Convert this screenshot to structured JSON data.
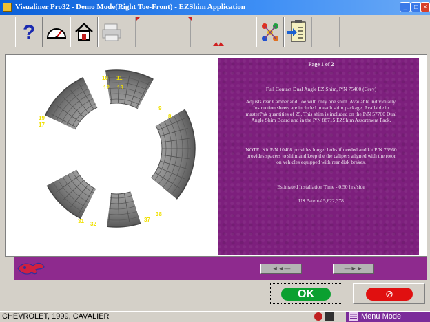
{
  "window": {
    "title": "Visualiner Pro32 - Demo Mode(Right Toe-Front) - EZShim Application"
  },
  "toolbar": {
    "items": [
      {
        "name": "help-icon"
      },
      {
        "name": "gauge-icon"
      },
      {
        "name": "home-icon"
      },
      {
        "name": "printer-icon"
      },
      {
        "name": "chart-icon"
      },
      {
        "name": "clipboard-icon"
      }
    ]
  },
  "shim": {
    "labels": [
      "10",
      "11",
      "12",
      "13",
      "9",
      "8",
      "19",
      "17",
      "31",
      "32",
      "37",
      "38"
    ]
  },
  "info": {
    "page": "Page 1 of 2",
    "title": "Full Contact Dual Angle EZ Shim, P/N 75400 (Grey)",
    "description": "Adjusts rear Camber and Toe with only one shim. Available individually. Instruction sheets are included in each shim package. Available in masterPak quantities of 25. This shim is included on the P/N 57700 Dual Angle Shim Board and in the P/N 88715 EZShim Assortment Pack.",
    "note": "NOTE: Kit P/N 10408 provides longer bolts if needed and kit P/N 75960 provides spacers to shim and keep the the calipers aligned with the rotor on vehicles equipped with rear disk brakes.",
    "install_time": "Estimated Installation Time - 0.50 hrs/side",
    "patent": "US Patent# 5,622,378"
  },
  "nav": {
    "prev_label": "◄◄—",
    "next_label": "—►►"
  },
  "buttons": {
    "ok_label": "OK",
    "cancel_label": "⊘"
  },
  "status": {
    "vehicle": "CHEVROLET, 1999, CAVALIER",
    "mode": "Menu Mode"
  },
  "colors": {
    "title_bar": "#0a5fd8",
    "panel": "#7d1f7d",
    "footer": "#8e2a8e",
    "ok": "#0aa030",
    "cancel": "#e01010"
  }
}
